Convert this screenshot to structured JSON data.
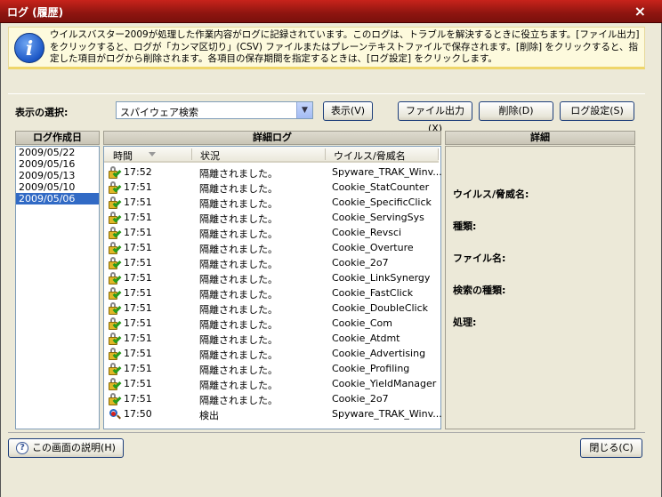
{
  "window": {
    "title": "ログ (履歴)",
    "close_label": "×"
  },
  "info": {
    "text": "ウイルスバスター2009が処理した作業内容がログに記録されています。このログは、トラブルを解決するときに役立ちます。[ファイル出力] をクリックすると、ログが「カンマ区切り」(CSV) ファイルまたはプレーンテキストファイルで保存されます。[削除] をクリックすると、指定した項目がログから削除されます。各項目の保存期間を指定するときは、[ログ設定] をクリックします。"
  },
  "toolbar": {
    "select_label": "表示の選択:",
    "dropdown_value": "スパイウェア検索",
    "show_button": "表示(V)",
    "export_button": "ファイル出力(X)",
    "delete_button": "削除(D)",
    "log_settings_button": "ログ設定(S)"
  },
  "date_panel": {
    "header": "ログ作成日",
    "dates": [
      "2009/05/22",
      "2009/05/16",
      "2009/05/13",
      "2009/05/10",
      "2009/05/06"
    ],
    "selected_index": 4
  },
  "log_panel": {
    "header": "詳細ログ",
    "columns": [
      "時間",
      "状況",
      "ウイルス/脅威名"
    ],
    "rows": [
      {
        "icon": "quarantine-icon",
        "time": "17:52",
        "status": "隔離されました。",
        "threat": "Spyware_TRAK_Winv..."
      },
      {
        "icon": "quarantine-icon",
        "time": "17:51",
        "status": "隔離されました。",
        "threat": "Cookie_StatCounter"
      },
      {
        "icon": "quarantine-icon",
        "time": "17:51",
        "status": "隔離されました。",
        "threat": "Cookie_SpecificClick"
      },
      {
        "icon": "quarantine-icon",
        "time": "17:51",
        "status": "隔離されました。",
        "threat": "Cookie_ServingSys"
      },
      {
        "icon": "quarantine-icon",
        "time": "17:51",
        "status": "隔離されました。",
        "threat": "Cookie_Revsci"
      },
      {
        "icon": "quarantine-icon",
        "time": "17:51",
        "status": "隔離されました。",
        "threat": "Cookie_Overture"
      },
      {
        "icon": "quarantine-icon",
        "time": "17:51",
        "status": "隔離されました。",
        "threat": "Cookie_2o7"
      },
      {
        "icon": "quarantine-icon",
        "time": "17:51",
        "status": "隔離されました。",
        "threat": "Cookie_LinkSynergy"
      },
      {
        "icon": "quarantine-icon",
        "time": "17:51",
        "status": "隔離されました。",
        "threat": "Cookie_FastClick"
      },
      {
        "icon": "quarantine-icon",
        "time": "17:51",
        "status": "隔離されました。",
        "threat": "Cookie_DoubleClick"
      },
      {
        "icon": "quarantine-icon",
        "time": "17:51",
        "status": "隔離されました。",
        "threat": "Cookie_Com"
      },
      {
        "icon": "quarantine-icon",
        "time": "17:51",
        "status": "隔離されました。",
        "threat": "Cookie_Atdmt"
      },
      {
        "icon": "quarantine-icon",
        "time": "17:51",
        "status": "隔離されました。",
        "threat": "Cookie_Advertising"
      },
      {
        "icon": "quarantine-icon",
        "time": "17:51",
        "status": "隔離されました。",
        "threat": "Cookie_Profiling"
      },
      {
        "icon": "quarantine-icon",
        "time": "17:51",
        "status": "隔離されました。",
        "threat": "Cookie_YieldManager"
      },
      {
        "icon": "quarantine-icon",
        "time": "17:51",
        "status": "隔離されました。",
        "threat": "Cookie_2o7"
      },
      {
        "icon": "detection-icon",
        "time": "17:50",
        "status": "検出",
        "threat": "Spyware_TRAK_Winv..."
      }
    ]
  },
  "detail_panel": {
    "header": "詳細",
    "labels": [
      "ウイルス/脅威名:",
      "種類:",
      "ファイル名:",
      "検索の種類:",
      "処理:"
    ]
  },
  "footer": {
    "help_button": "この画面の説明(H)",
    "help_icon_glyph": "?",
    "close_button": "閉じる(C)"
  },
  "colors": {
    "title_bar": "#b41c16",
    "selection": "#316ac5",
    "info_background": "#fdfadd"
  }
}
